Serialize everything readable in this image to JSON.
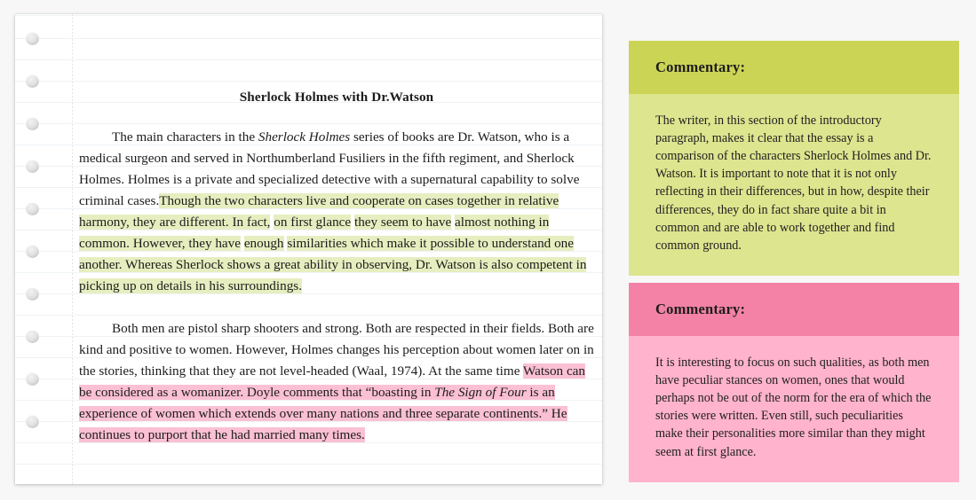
{
  "background_color": "#f7f7f8",
  "paper": {
    "name": "lined-notebook-page",
    "background_color": "#ffffff",
    "rule_color": "#eef3f6",
    "margin_line_color": "#e3e3e3",
    "hole_count": 10,
    "title": "Sherlock Holmes with Dr.Watson",
    "paragraphs": [
      {
        "id": "paragraph-1",
        "runs": [
          {
            "text": "The main characters in the ",
            "style": "normal",
            "highlight": "none"
          },
          {
            "text": "Sherlock Holmes",
            "style": "italic",
            "highlight": "none"
          },
          {
            "text": " series of books are Dr. Watson, who is a medical surgeon and served in Northumberland Fusiliers in the fifth regiment, and Sherlock Holmes. Holmes is a private and specialized detective with a supernatural capability to solve criminal cases.",
            "style": "normal",
            "highlight": "none"
          },
          {
            "text": "Though the two characters live and cooperate on cases together in relative harmony, they are different. In fact,",
            "style": "normal",
            "highlight": "green"
          },
          {
            "text": " ",
            "style": "normal",
            "highlight": "none"
          },
          {
            "text": "on first glance",
            "style": "normal",
            "highlight": "green"
          },
          {
            "text": " ",
            "style": "normal",
            "highlight": "none"
          },
          {
            "text": "they seem to have",
            "style": "normal",
            "highlight": "green"
          },
          {
            "text": " ",
            "style": "normal",
            "highlight": "none"
          },
          {
            "text": "almost nothing in common. However, they have",
            "style": "normal",
            "highlight": "green"
          },
          {
            "text": " ",
            "style": "normal",
            "highlight": "none"
          },
          {
            "text": "enough",
            "style": "normal",
            "highlight": "green"
          },
          {
            "text": " ",
            "style": "normal",
            "highlight": "none"
          },
          {
            "text": "similarities which make it possible to understand one another. Whereas Sherlock shows a great ability in observing, Dr. Watson is also competent in picking up on details in his surroundings.",
            "style": "normal",
            "highlight": "green"
          }
        ]
      },
      {
        "id": "paragraph-2",
        "runs": [
          {
            "text": "Both men are pistol sharp shooters and strong. Both are respected in their fields. Both are kind and positive to women. However, Holmes changes his perception about women later on in the stories, thinking that they are not level-headed (Waal, 1974). At the same time ",
            "style": "normal",
            "highlight": "none"
          },
          {
            "text": "Watson can be considered as a womanizer. Doyle comments that “boasting in ",
            "style": "normal",
            "highlight": "pink"
          },
          {
            "text": "The Sign of Four",
            "style": "italic",
            "highlight": "pink"
          },
          {
            "text": " is an experience of women which extends over many nations and three separate continents.” He continues to purport that he had married many times.",
            "style": "normal",
            "highlight": "pink"
          }
        ]
      }
    ]
  },
  "commentary_cards": [
    {
      "id": "commentary-green",
      "heading": "Commentary:",
      "header_color": "#ccd455",
      "body_color": "#dde58f",
      "body": "The writer, in this section of the introductory paragraph, makes it clear that the essay is a comparison of the characters Sherlock Holmes and Dr. Watson. It is important to note that it is not only reflecting in their differences, but in how, despite their differences, they do in fact share quite a bit in common and are able to work together and find common ground."
    },
    {
      "id": "commentary-pink",
      "heading": "Commentary:",
      "header_color": "#f382a6",
      "body_color": "#ffb3cc",
      "body": "It is interesting to focus on such qualities, as both men have peculiar stances on women, ones that would perhaps not be out of the norm for the era of which the stories were written. Even still, such peculiarities make their personalities more similar than they might seem at first glance."
    }
  ],
  "highlight_colors": {
    "green": "#e6eec0",
    "pink": "#fbc0d4"
  }
}
